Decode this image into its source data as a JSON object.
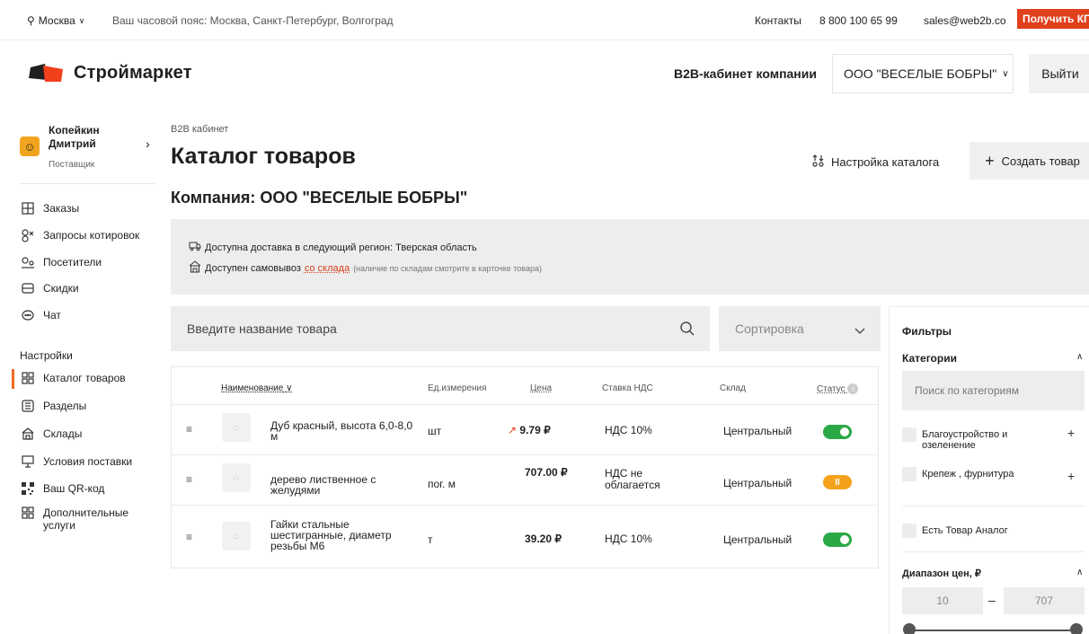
{
  "topbar": {
    "city": "Москва",
    "timezone": "Ваш часовой пояс: Москва, Санкт-Петербург, Волгоград",
    "contacts": "Контакты",
    "phone": "8 800 100 65 99",
    "email": "sales@web2b.co",
    "get_kp": "Получить КП"
  },
  "header": {
    "brand": "Строймаркет",
    "b2b_cabinet": "B2B-кабинет компании",
    "company_selected": "ООО \"ВЕСЕЛЫЕ БОБРЫ\"",
    "logout": "Выйти"
  },
  "user": {
    "name": "Копейкин Дмитрий",
    "role": "Поставщик"
  },
  "sidebar": {
    "items": [
      {
        "label": "Заказы",
        "icon": "orders-icon"
      },
      {
        "label": "Запросы котировок",
        "icon": "quotes-icon"
      },
      {
        "label": "Посетители",
        "icon": "visitors-icon"
      },
      {
        "label": "Скидки",
        "icon": "discounts-icon"
      },
      {
        "label": "Чат",
        "icon": "chat-icon"
      }
    ],
    "settings_title": "Настройки",
    "settings_items": [
      {
        "label": "Каталог товаров",
        "icon": "catalog-icon",
        "active": true
      },
      {
        "label": "Разделы",
        "icon": "sections-icon"
      },
      {
        "label": "Склады",
        "icon": "warehouse-icon"
      },
      {
        "label": "Условия поставки",
        "icon": "delivery-terms-icon"
      },
      {
        "label": "Ваш QR-код",
        "icon": "qr-icon"
      },
      {
        "label": "Дополнительные услуги",
        "icon": "services-icon"
      }
    ]
  },
  "main": {
    "breadcrumb": "B2B кабинет",
    "title": "Каталог товаров",
    "settings_button": "Настройка каталога",
    "create_button": "Создать товар",
    "company_title": "Компания: ООО \"ВЕСЕЛЫЕ БОБРЫ\"",
    "delivery_text": "Доступна доставка в следующий регион: Тверская область",
    "pickup_text": "Доступен самовывоз",
    "pickup_link": "со склада",
    "pickup_note": "(наличие по складам смотрите в карточке товара)",
    "search_placeholder": "Введите название товара",
    "sort_placeholder": "Сортировка"
  },
  "table": {
    "columns": {
      "name": "Наименование",
      "unit": "Ед.измерения",
      "price": "Цена",
      "vat": "Ставка НДС",
      "warehouse": "Склад",
      "status": "Статус"
    },
    "rows": [
      {
        "name": "Дуб красный, высота 6,0-8,0 м",
        "unit": "шт",
        "price": "9.79 ₽",
        "vat": "НДС 10%",
        "warehouse": "Центральный",
        "status": "active"
      },
      {
        "name": "дерево лиственное с желудями",
        "unit": "пог. м",
        "price": "707.00 ₽",
        "vat": "НДС не облагается",
        "warehouse": "Центральный",
        "status": "paused"
      },
      {
        "name": "Гайки стальные шестигранные, диаметр резьбы М6",
        "unit": "т",
        "price": "39.20 ₽",
        "vat": "НДС 10%",
        "warehouse": "Центральный",
        "status": "active"
      }
    ]
  },
  "filters": {
    "title": "Фильтры",
    "categories_title": "Категории",
    "categories_search_placeholder": "Поиск по категориям",
    "category_items": [
      "Благоустройство и озеленение",
      "Крепеж , фурнитура"
    ],
    "analog": "Есть Товар Аналог",
    "price_range_title": "Диапазон цен, ₽",
    "price_min": "10",
    "price_max": "707"
  },
  "colors": {
    "accent": "#e0401c",
    "active_toggle": "#2aa846",
    "paused_toggle": "#f4a21b"
  }
}
